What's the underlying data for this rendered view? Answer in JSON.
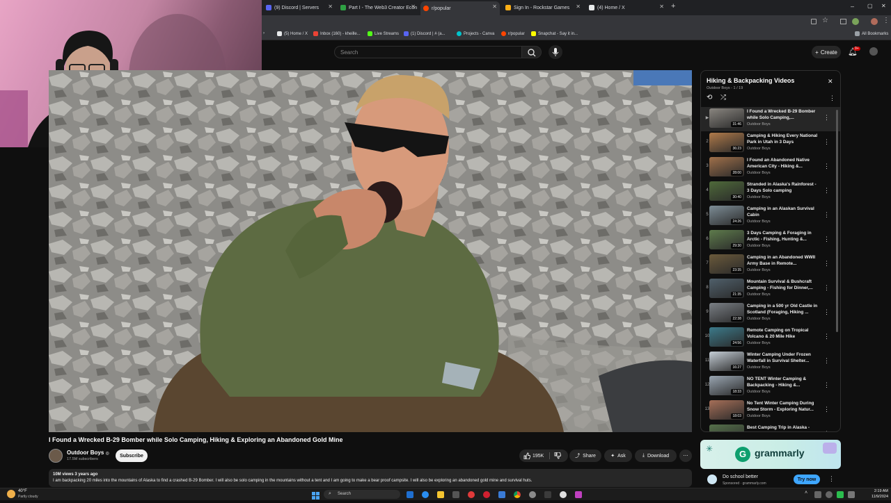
{
  "browser": {
    "tabs": [
      {
        "label": "(9) Discord | Servers",
        "color": "#5865f2"
      },
      {
        "label": "Part I - The Web3 Creator Econ",
        "color": "#2ea043"
      },
      {
        "label": "r/popular",
        "color": "#ff4500"
      },
      {
        "label": "Sign In - Rockstar Games",
        "color": "#fcaf17"
      },
      {
        "label": "(4) Home / X",
        "color": "#e7e9ea"
      }
    ],
    "new_tab": "+",
    "window_controls": {
      "minimize": "–",
      "maximize": "▢",
      "close": "✕"
    },
    "bookmarks": [
      {
        "label": "(5) Home / X",
        "color": "#e7e9ea"
      },
      {
        "label": "Inbox (160) - kheille...",
        "color": "#ea4335"
      },
      {
        "label": "Live Streams",
        "color": "#53fc18"
      },
      {
        "label": "(1) Discord | # (a...",
        "color": "#5865f2"
      },
      {
        "label": "Projects - Canva",
        "color": "#00c4cc"
      },
      {
        "label": "r/popular",
        "color": "#ff4500"
      },
      {
        "label": "Snapchat - Say it in...",
        "color": "#fffc00"
      }
    ],
    "all_bookmarks": "All Bookmarks"
  },
  "youtube": {
    "search_placeholder": "Search",
    "create_label": "Create",
    "notif_count": "9+"
  },
  "video": {
    "title": "I Found a Wrecked B-29 Bomber while Solo Camping, Hiking & Exploring an Abandoned Gold Mine",
    "channel": "Outdoor Boys",
    "verified": "◎",
    "subscribers": "17.5M subscribers",
    "subscribe_label": "Subscribe",
    "likes": "195K",
    "share_label": "Share",
    "ask_label": "Ask",
    "download_label": "Download",
    "more_label": "⋯",
    "meta": "10M views  3 years ago",
    "description": "I am backpacking 20 miles into the mountains of Alaska to find a crashed B-29 Bomber. I will also be solo camping in the mountains without a tent and I am going to make a bear proof campsite. I will also be exploring an abandoned gold mine and survival huts."
  },
  "playlist": {
    "title": "Hiking & Backpacking Videos",
    "subtitle": "Outdoor Boys - 1 / 19",
    "close": "✕",
    "items": [
      {
        "index": "▶",
        "title": "I Found a Wrecked B-29 Bomber while Solo Camping,...",
        "channel": "Outdoor Boys",
        "duration": "31:46",
        "thumb": "#8a8680"
      },
      {
        "index": "2",
        "title": "Camping & Hiking Every National Park in Utah in 3 Days",
        "channel": "Outdoor Boys",
        "duration": "36:23",
        "thumb": "#b07a4a"
      },
      {
        "index": "3",
        "title": "I Found an Abandoned Native American City - Hiking &...",
        "channel": "Outdoor Boys",
        "duration": "28:00",
        "thumb": "#a0704a"
      },
      {
        "index": "4",
        "title": "Stranded in Alaska's Rainforest - 3 Days Solo camping",
        "channel": "Outdoor Boys",
        "duration": "30:40",
        "thumb": "#4f6a3a"
      },
      {
        "index": "5",
        "title": "Camping in an Alaskan Survival Cabin",
        "channel": "Outdoor Boys",
        "duration": "24:26",
        "thumb": "#7d8d96"
      },
      {
        "index": "6",
        "title": "3 Days Camping & Foraging in Arctic - Fishing, Hunting &...",
        "channel": "Outdoor Boys",
        "duration": "29:30",
        "thumb": "#5e7b4c"
      },
      {
        "index": "7",
        "title": "Camping in an Abandoned WWII Army Base in Remote...",
        "channel": "Outdoor Boys",
        "duration": "23:35",
        "thumb": "#6b5a3b"
      },
      {
        "index": "8",
        "title": "Mountain Survival & Bushcraft Camping - Fishing for Dinner,...",
        "channel": "Outdoor Boys",
        "duration": "21:35",
        "thumb": "#50606b"
      },
      {
        "index": "9",
        "title": "Camping in a 500 yr Old Castle in Scotland (Foraging, Hiking ...",
        "channel": "Outdoor Boys",
        "duration": "22:38",
        "thumb": "#7a7f85"
      },
      {
        "index": "10",
        "title": "Remote Camping on Tropical Volcano & 20 Mile Hike",
        "channel": "Outdoor Boys",
        "duration": "24:56",
        "thumb": "#3c7a8a"
      },
      {
        "index": "11",
        "title": "Winter Camping Under Frozen Waterfall in Survival Shelter...",
        "channel": "Outdoor Boys",
        "duration": "16:27",
        "thumb": "#c5ced6"
      },
      {
        "index": "12",
        "title": "NO TENT Winter Camping & Backpacking - Hiking &...",
        "channel": "Outdoor Boys",
        "duration": "18:33",
        "thumb": "#9aa6b2"
      },
      {
        "index": "13",
        "title": "No Tent Winter Camping During Snow Storm - Exploring Natur...",
        "channel": "Outdoor Boys",
        "duration": "18:03",
        "thumb": "#a66f58"
      },
      {
        "index": "14",
        "title": "Best Camping Trip in Alaska -",
        "channel": "Outdoor Boys",
        "duration": "",
        "thumb": "#55704a"
      }
    ]
  },
  "ad": {
    "brand": "grammarly",
    "headline": "Do school better",
    "sponsored": "Sponsored · grammarly.com",
    "cta": "Try now"
  },
  "taskbar": {
    "weather_temp": "40°F",
    "weather_desc": "Partly cloudy",
    "search": "Search",
    "time": "2:19 AM",
    "date": "11/9/2024"
  }
}
